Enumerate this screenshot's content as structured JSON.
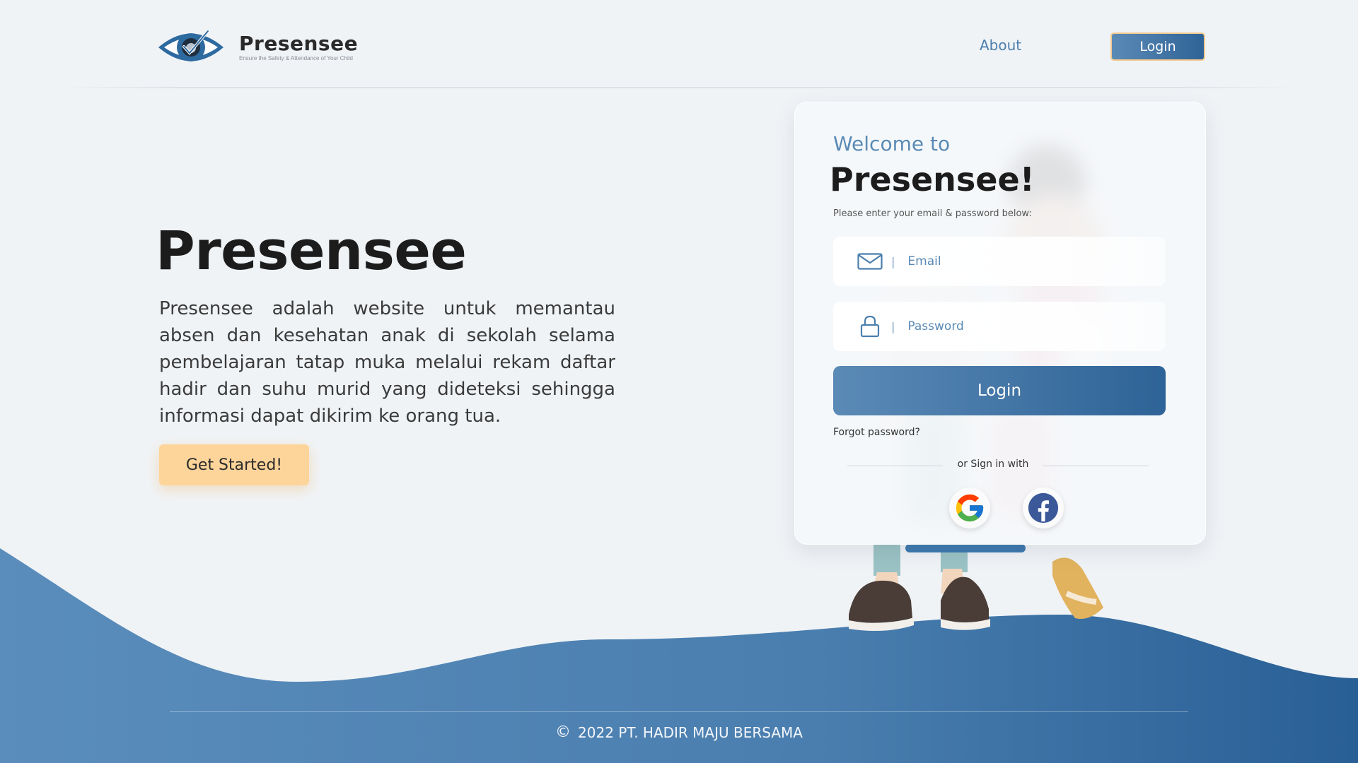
{
  "header": {
    "brand_name": "Presensee",
    "brand_tagline": "Ensure the Safety & Attendance of Your Child",
    "nav_about": "About",
    "nav_login": "Login"
  },
  "hero": {
    "title": "Presensee",
    "description": "Presensee adalah website untuk memantau absen dan kesehatan anak di sekolah selama pembelajaran tatap muka melalui rekam daftar hadir dan suhu murid yang dideteksi sehingga informasi dapat dikirim ke orang tua.",
    "cta_label": "Get Started!"
  },
  "login_card": {
    "welcome": "Welcome to",
    "brand": "Presensee!",
    "instruction": "Please enter your email & password below:",
    "email_placeholder": "Email",
    "password_placeholder": "Password",
    "login_button": "Login",
    "forgot_password": "Forgot password?",
    "or_sign_in_with": "or Sign in with",
    "social": [
      {
        "name": "google",
        "icon": "google-icon"
      },
      {
        "name": "facebook",
        "icon": "facebook-icon"
      }
    ]
  },
  "footer": {
    "copyright_icon": "copyright-icon",
    "text": "2022 PT. HADIR MAJU BERSAMA"
  },
  "colors": {
    "background": "#f0f3f6",
    "primary_blue": "#4c7fad",
    "dark_blue": "#2e6397",
    "accent_orange": "#fdd49a",
    "text_dark": "#1c1c1c"
  }
}
